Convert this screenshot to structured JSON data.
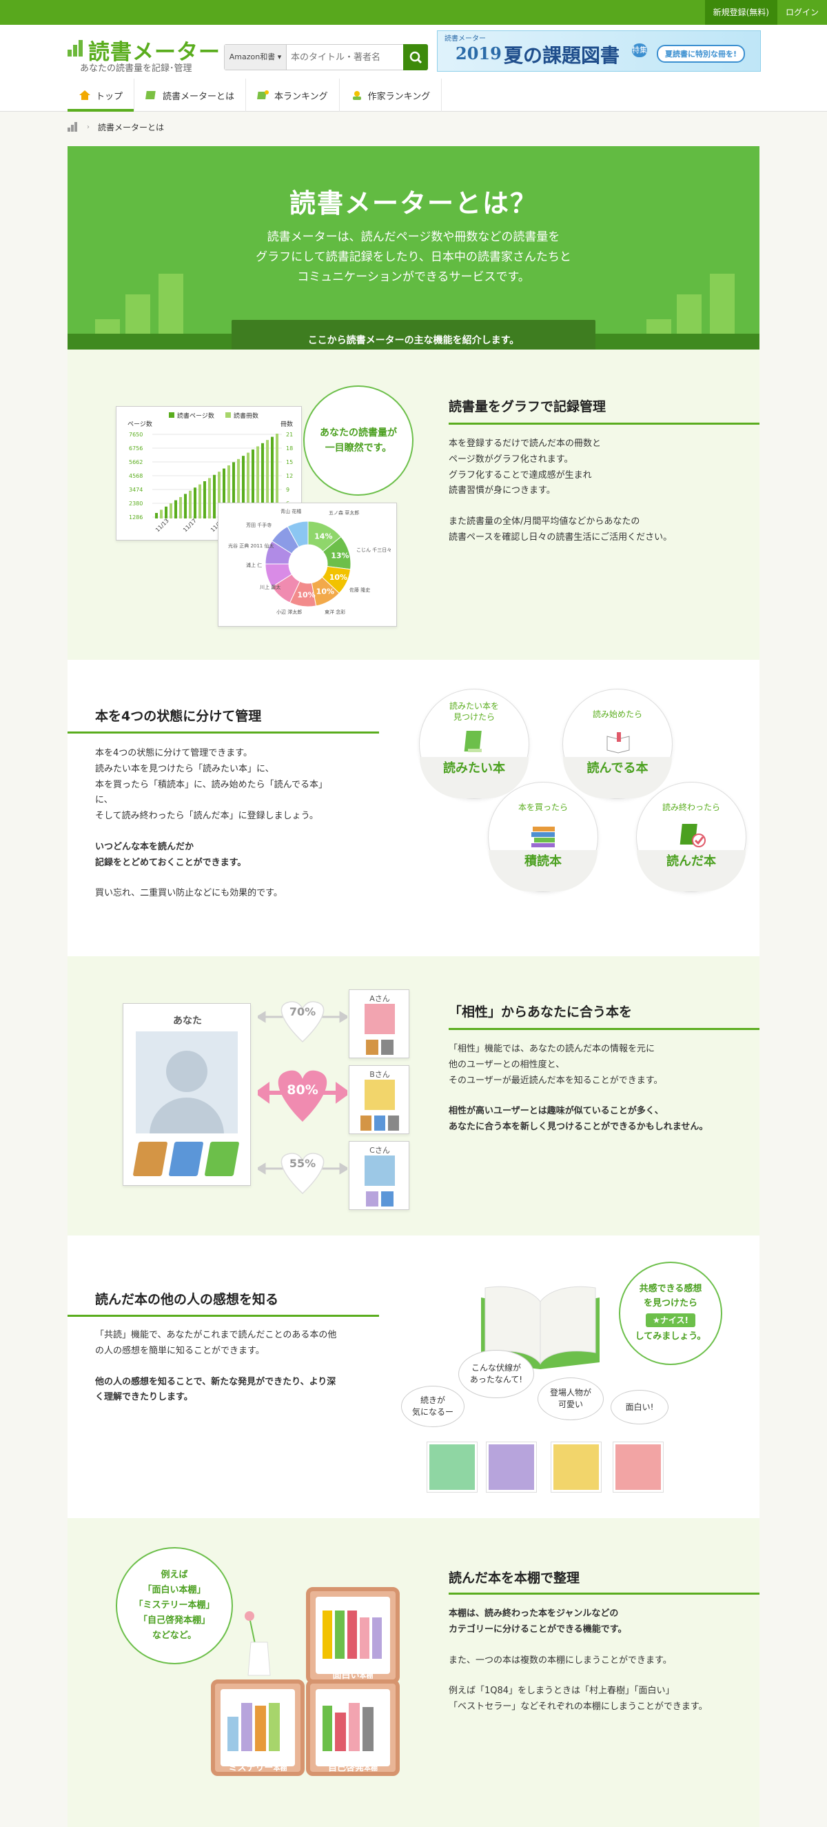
{
  "header": {
    "top_links": {
      "register": "新規登録(無料)",
      "login": "ログイン"
    },
    "logo": {
      "name": "読書メーター",
      "tagline": "あなたの読書量を記録･管理"
    },
    "search": {
      "select_value": "Amazon和書",
      "placeholder": "本のタイトル・著者名"
    },
    "banner": {
      "small": "読書メーター",
      "year": "2019",
      "title": "夏の課題図書",
      "side": "特集",
      "pill": "夏読書に特別な冊を!"
    },
    "nav": [
      {
        "label": "トップ"
      },
      {
        "label": "読書メーターとは"
      },
      {
        "label": "本ランキング"
      },
      {
        "label": "作家ランキング"
      }
    ]
  },
  "breadcrumb": {
    "current": "読書メーターとは"
  },
  "hero": {
    "title": "読書メーターとは？",
    "lead": [
      "読書メーターは、読んだページ数や冊数などの読書量を",
      "グラフにして読書記録をしたり、日本中の読書家さんたちと",
      "コミュニケーションができるサービスです。"
    ],
    "intro": "ここから読書メーターの主な機能を紹介します。"
  },
  "sec1": {
    "title": "読書量をグラフで記録管理",
    "p1": [
      "本を登録するだけで読んだ本の冊数と",
      "ページ数がグラフ化されます。",
      "グラフ化することで達成感が生まれ",
      "読書習慣が身につきます。"
    ],
    "p2": [
      "また読書量の全体/月間平均値などからあなたの",
      "読書ペースを確認し日々の読書生活にご活用ください。"
    ],
    "bubble": [
      "あなたの読書量が",
      "一目瞭然です。"
    ],
    "chart": {
      "legend_pages": "読書ページ数",
      "legend_books": "読書冊数",
      "left_unit": "ページ数",
      "right_unit": "冊数",
      "left_ticks": [
        "7650",
        "6756",
        "5662",
        "4568",
        "3474",
        "2380",
        "1286"
      ],
      "right_ticks": [
        "21",
        "18",
        "15",
        "12",
        "9",
        "6",
        "3"
      ],
      "x_ticks": [
        "11/13",
        "11/17",
        "11/20",
        "11/24"
      ],
      "pie_labels": [
        "14%",
        "13%",
        "10%",
        "10%",
        "10%"
      ]
    }
  },
  "sec2": {
    "title": "本を4つの状態に分けて管理",
    "p1": [
      "本を4つの状態に分けて管理できます。",
      "読みたい本を見つけたら「読みたい本」に、",
      "本を買ったら「積読本」に、読み始めたら「読んでる本」",
      "に、",
      "そして読み終わったら「読んだ本」に登録しましょう。"
    ],
    "p2": [
      "いつどんな本を読んだか",
      "記録をとどめておくことができます。"
    ],
    "p3": "買い忘れ、二重買い防止などにも効果的です。",
    "states": [
      {
        "top": [
          "読みたい本を",
          "見つけたら"
        ],
        "label": "読みたい本"
      },
      {
        "top": [
          "読み始めたら"
        ],
        "label": "読んでる本"
      },
      {
        "top": [
          "本を買ったら"
        ],
        "label": "積読本"
      },
      {
        "top": [
          "読み終わったら"
        ],
        "label": "読んだ本"
      }
    ]
  },
  "sec3": {
    "title": "「相性」からあなたに合う本を",
    "p1": [
      "「相性」機能では、あなたの読んだ本の情報を元に",
      "他のユーザーとの相性度と、",
      "そのユーザーが最近読んだ本を知ることができます。"
    ],
    "p2": [
      "相性が高いユーザーとは趣味が似ていることが多く、",
      "あなたに合う本を新しく見つけることができるかもしれません。"
    ],
    "you": "あなた",
    "matches": [
      {
        "name": "Aさん",
        "percent": "70%"
      },
      {
        "name": "Bさん",
        "percent": "80%"
      },
      {
        "name": "Cさん",
        "percent": "55%"
      }
    ]
  },
  "sec4": {
    "title": "読んだ本の他の人の感想を知る",
    "p1": [
      "「共読」機能で、あなたがこれまで読んだことのある本の他",
      "の人の感想を簡単に知ることができます。"
    ],
    "p2": [
      "他の人の感想を知ることで、新たな発見ができたり、より深",
      "く理解できたりします。"
    ],
    "bubble": {
      "l1": "共感できる感想",
      "l2": "を見つけたら",
      "badge": "★ナイス!",
      "l3": "してみましょう。"
    },
    "speech": [
      [
        "続きが",
        "気になるー"
      ],
      [
        "こんな伏線が",
        "あったなんて!"
      ],
      [
        "登場人物が",
        "可愛い"
      ],
      [
        "面白い!"
      ]
    ],
    "colors": {
      "green": "#8fd6a3",
      "purple": "#b7a4dc",
      "yellow": "#f2d56b",
      "pink": "#f2a4a4"
    }
  },
  "sec5": {
    "title": "読んだ本を本棚で整理",
    "p1": [
      "本棚は、読み終わった本をジャンルなどの",
      "カテゴリーに分けることができる機能です。"
    ],
    "p2": "また、一つの本は複数の本棚にしまうことができます。",
    "p3": [
      "例えば「1Q84」をしまうときは「村上春樹」「面白い」",
      "「ベストセラー」などそれぞれの本棚にしまうことができます。"
    ],
    "bubble": [
      "例えば",
      "「面白い本棚」",
      "「ミステリー本棚」",
      "「自己啓発本棚」",
      "などなど。"
    ],
    "shelves": {
      "funny": "面白い",
      "mystery": "ミステリー",
      "self": "自己啓発",
      "suffix": "本棚"
    }
  },
  "colors": {
    "brand": "#5aad1e",
    "hero": "#62bb42",
    "dark": "#3e7d20"
  }
}
